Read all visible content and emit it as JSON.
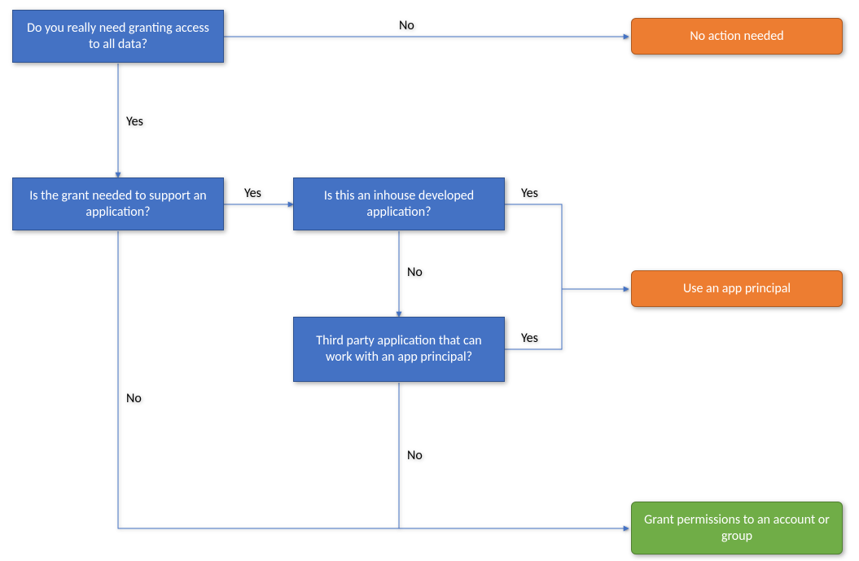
{
  "chart_data": {
    "type": "flowchart",
    "nodes": [
      {
        "id": "q1",
        "kind": "decision",
        "label": "Do you really need granting access to all data?",
        "color": "blue"
      },
      {
        "id": "t1",
        "kind": "terminal",
        "label": "No action needed",
        "color": "orange"
      },
      {
        "id": "q2",
        "kind": "decision",
        "label": "Is the grant needed to support an application?",
        "color": "blue"
      },
      {
        "id": "q3",
        "kind": "decision",
        "label": "Is this an inhouse developed application?",
        "color": "blue"
      },
      {
        "id": "q4",
        "kind": "decision",
        "label": "Third party application that can work with an app principal?",
        "color": "blue"
      },
      {
        "id": "t2",
        "kind": "terminal",
        "label": "Use an app principal",
        "color": "orange"
      },
      {
        "id": "t3",
        "kind": "terminal",
        "label": "Grant permissions to an account or group",
        "color": "green"
      }
    ],
    "edges": [
      {
        "from": "q1",
        "to": "t1",
        "label": "No"
      },
      {
        "from": "q1",
        "to": "q2",
        "label": "Yes"
      },
      {
        "from": "q2",
        "to": "q3",
        "label": "Yes"
      },
      {
        "from": "q2",
        "to": "t3",
        "label": "No"
      },
      {
        "from": "q3",
        "to": "t2",
        "label": "Yes"
      },
      {
        "from": "q3",
        "to": "q4",
        "label": "No"
      },
      {
        "from": "q4",
        "to": "t2",
        "label": "Yes"
      },
      {
        "from": "q4",
        "to": "t3",
        "label": "No"
      }
    ]
  },
  "labels": {
    "yes": "Yes",
    "no": "No"
  }
}
